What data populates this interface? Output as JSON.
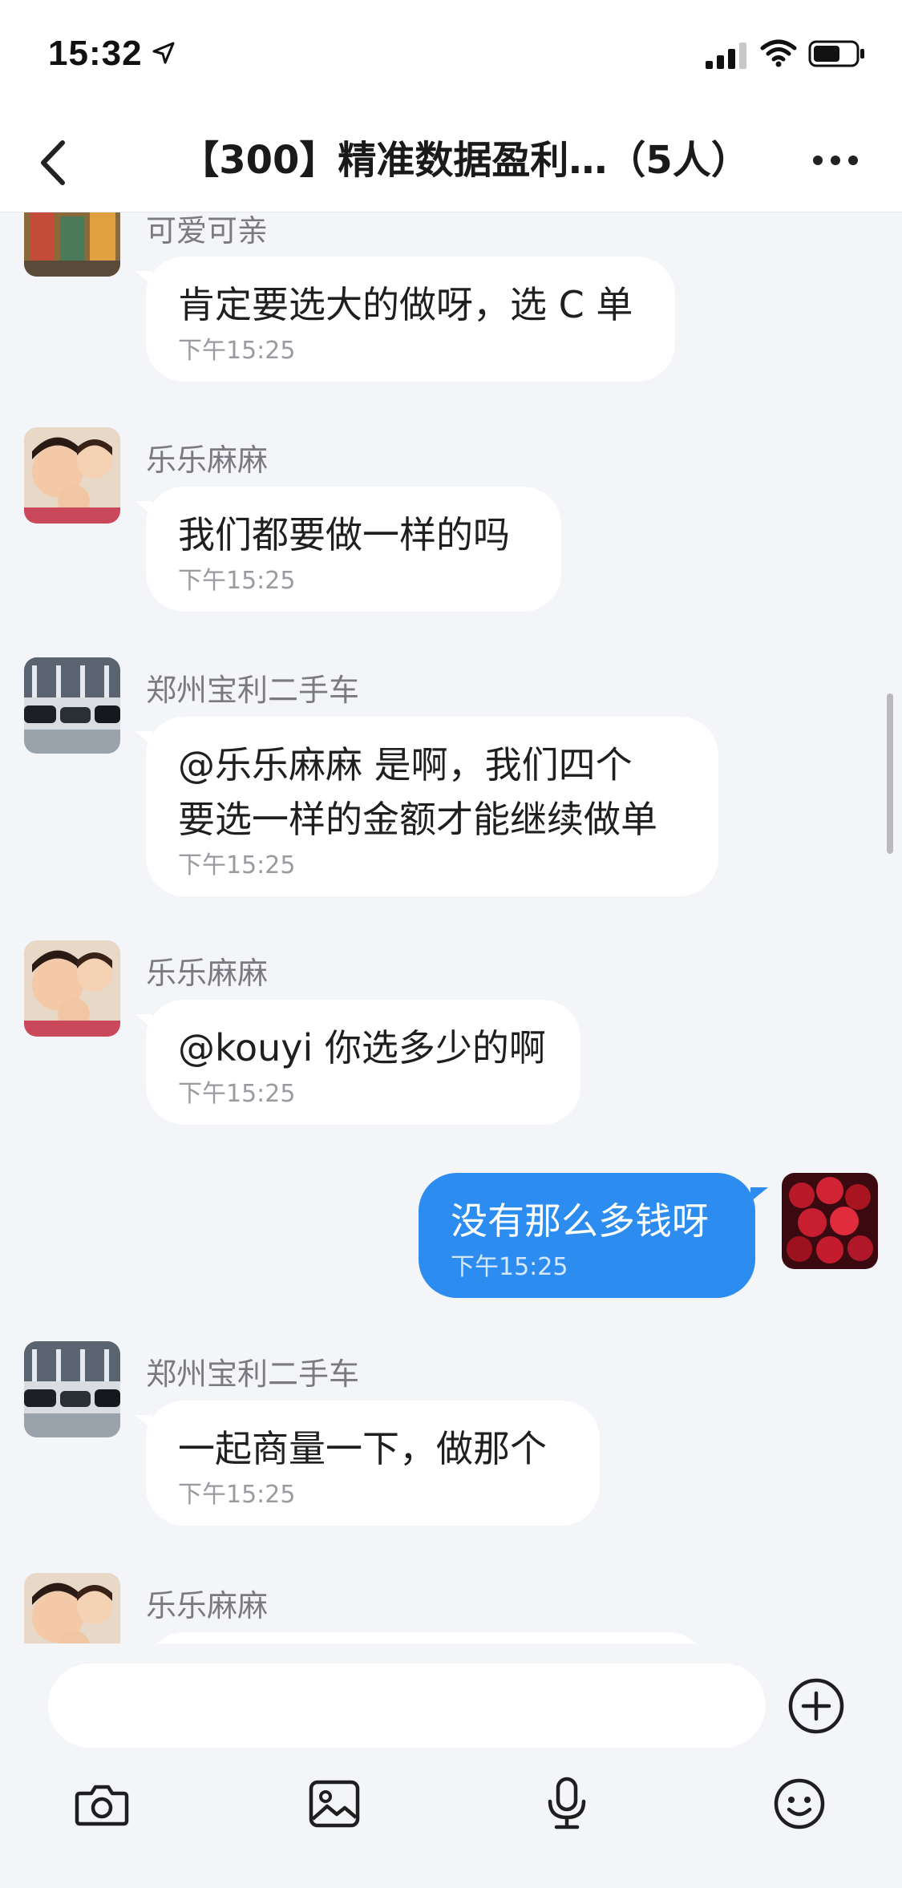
{
  "status": {
    "time": "15:32"
  },
  "nav": {
    "title": "【300】精准数据盈利…（5人）"
  },
  "messages": [
    {
      "sender": "可爱可亲",
      "text_lines": [
        "肯定要选大的做呀，选 C 单"
      ],
      "time": "下午15:25",
      "avatar": "shop-avatar"
    },
    {
      "sender": "乐乐麻麻",
      "text_lines": [
        "我们都要做一样的吗"
      ],
      "time": "下午15:25",
      "avatar": "family-avatar"
    },
    {
      "sender": "郑州宝利二手车",
      "text_lines": [
        "@乐乐麻麻 是啊，我们四个",
        "要选一样的金额才能继续做单"
      ],
      "time": "下午15:25",
      "avatar": "car-lot-avatar"
    },
    {
      "sender": "乐乐麻麻",
      "text_lines": [
        "@kouyi 你选多少的啊"
      ],
      "time": "下午15:25",
      "avatar": "family-avatar"
    },
    {
      "sender": "",
      "text_lines": [
        "没有那么多钱呀"
      ],
      "time": "下午15:25",
      "avatar": "roses-avatar",
      "self": true
    },
    {
      "sender": "郑州宝利二手车",
      "text_lines": [
        "一起商量一下，做那个"
      ],
      "time": "下午15:25",
      "avatar": "car-lot-avatar"
    },
    {
      "sender": "乐乐麻麻",
      "text_lines": [],
      "time": "",
      "avatar": "family-avatar"
    }
  ],
  "composer": {
    "placeholder": ""
  },
  "colors": {
    "self_bubble": "#2d8cf0",
    "other_bubble": "#ffffff",
    "background": "#f4f5f9"
  }
}
